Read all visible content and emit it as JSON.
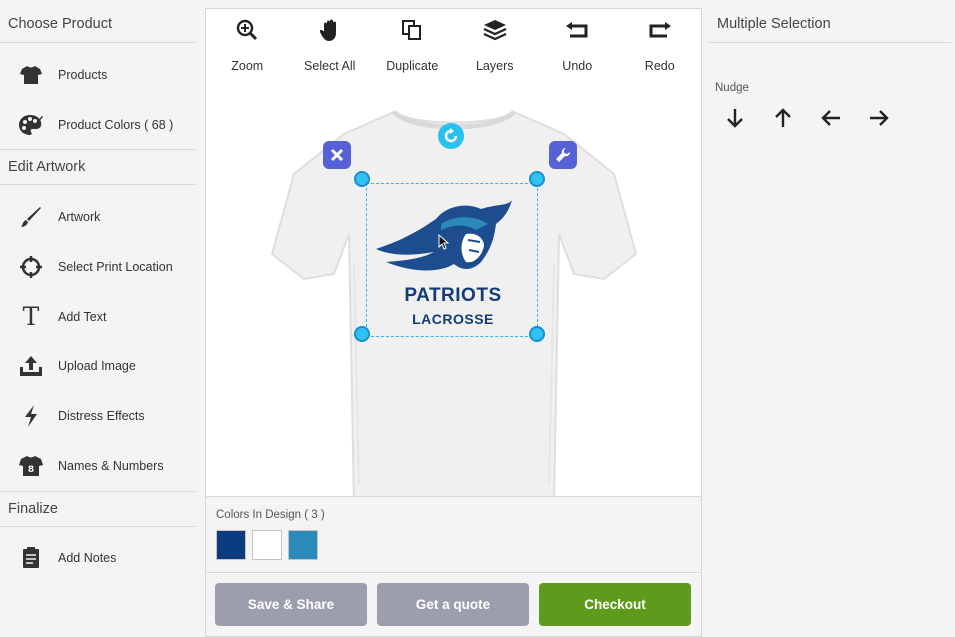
{
  "sidebar": {
    "sections": [
      {
        "title": "Choose Product",
        "items": [
          {
            "label": "Products",
            "icon": "tshirt-icon"
          },
          {
            "label": "Product Colors  ( 68 )",
            "icon": "palette-icon"
          }
        ]
      },
      {
        "title": "Edit Artwork",
        "items": [
          {
            "label": "Artwork",
            "icon": "brush-icon"
          },
          {
            "label": "Select Print Location",
            "icon": "crosshair-icon"
          },
          {
            "label": "Add Text",
            "icon": "text-icon"
          },
          {
            "label": "Upload Image",
            "icon": "upload-icon"
          },
          {
            "label": "Distress Effects",
            "icon": "lightning-icon"
          },
          {
            "label": "Names & Numbers",
            "icon": "jersey-icon"
          }
        ]
      },
      {
        "title": "Finalize",
        "items": [
          {
            "label": "Add Notes",
            "icon": "notes-icon"
          }
        ]
      }
    ]
  },
  "toolbar": {
    "tools": [
      {
        "label": "Zoom",
        "icon": "zoom-in-icon"
      },
      {
        "label": "Select All",
        "icon": "hand-icon"
      },
      {
        "label": "Duplicate",
        "icon": "duplicate-icon"
      },
      {
        "label": "Layers",
        "icon": "layers-icon"
      },
      {
        "label": "Undo",
        "icon": "undo-icon"
      },
      {
        "label": "Redo",
        "icon": "redo-icon"
      }
    ]
  },
  "design": {
    "line1": "PATRIOTS",
    "line2": "LACROSSE",
    "text_color": "#123c79",
    "selection_color": "#2fc2f2",
    "control_color": "#5661d6"
  },
  "colors_in_design": {
    "label": "Colors In Design ( 3 )",
    "swatches": [
      "#0b3a7e",
      "#ffffff",
      "#2b89bb"
    ]
  },
  "actions": {
    "save_label": "Save & Share",
    "quote_label": "Get a quote",
    "checkout_label": "Checkout",
    "save_color": "#9c9eae",
    "quote_color": "#9c9eae",
    "checkout_color": "#5e9a1c"
  },
  "right_panel": {
    "title": "Multiple Selection",
    "nudge_label": "Nudge",
    "arrows": [
      "arrow-down-icon",
      "arrow-up-icon",
      "arrow-left-icon",
      "arrow-right-icon"
    ]
  }
}
